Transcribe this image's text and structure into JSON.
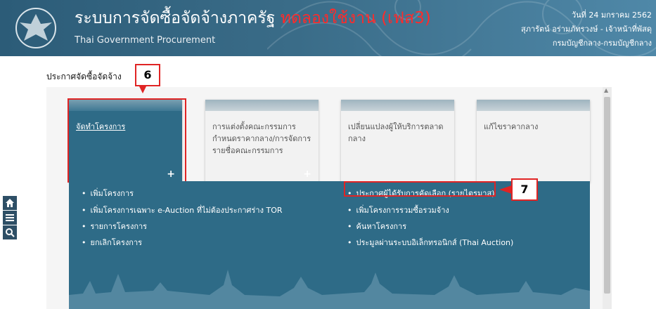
{
  "header": {
    "title_th": "ระบบการจัดซื้อจัดจ้างภาครัฐ",
    "trial_label": "ทดลองใช้งาน (เฟส3)",
    "title_en": "Thai Government Procurement",
    "date": "วันที่ 24 มกราคม 2562",
    "user": "สุภารัตน์ อร่ามภัทรวงษ์ - เจ้าหน้าที่พัสดุ",
    "department": "กรมบัญชีกลาง-กรมบัญชีกลาง"
  },
  "page_title": "ประกาศจัดซื้อจัดจ้าง",
  "callouts": {
    "step6": "6",
    "step7": "7"
  },
  "cards": [
    {
      "label": "จัดทำโครงการ",
      "plus": "+"
    },
    {
      "label": "การแต่งตั้งคณะกรรมการ กำหนดราคากลาง/การจัดการ รายชื่อคณะกรรมการ",
      "plus": "+"
    },
    {
      "label": "เปลี่ยนแปลงผู้ให้บริการตลาดกลาง"
    },
    {
      "label": "แก้ไขราคากลาง"
    }
  ],
  "menu": {
    "left": [
      "เพิ่มโครงการ",
      "เพิ่มโครงการเฉพาะ e-Auction ที่ไม่ต้องประกาศร่าง TOR",
      "รายการโครงการ",
      "ยกเลิกโครงการ"
    ],
    "right": [
      "ประกาศผู้ได้รับการคัดเลือก (รายไตรมาส)",
      "เพิ่มโครงการรวมซื้อรวมจ้าง",
      "ค้นหาโครงการ",
      "ประมูลผ่านระบบอิเล็กทรอนิกส์ (Thai Auction)"
    ]
  },
  "tools": [
    "home-icon",
    "menu-icon",
    "search-icon"
  ],
  "colors": {
    "header": "#2c5c78",
    "panel_blue": "#2e6b87",
    "highlight": "#e02424",
    "trial": "#ff2a2a"
  }
}
